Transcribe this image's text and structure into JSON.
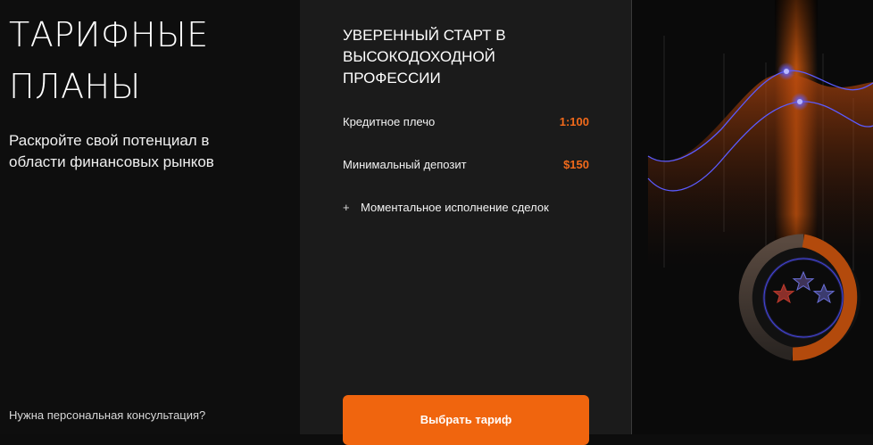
{
  "left": {
    "title_line1": "ТАРИФНЫЕ",
    "title_line2": "ПЛАНЫ",
    "subtitle_line1": "Раскройте свой потенциал в",
    "subtitle_line2": "области финансовых рынков",
    "consultation": "Нужна персональная консультация?"
  },
  "plan": {
    "title_line1": "УВЕРЕННЫЙ СТАРТ В",
    "title_line2": "ВЫСОКОДОХОДНОЙ",
    "title_line3": "ПРОФЕССИИ",
    "rows": [
      {
        "label": "Кредитное плечо",
        "value": "1:100"
      },
      {
        "label": "Минимальный депозит",
        "value": "$150"
      }
    ],
    "feature_icon": "+",
    "feature": "Моментальное исполнение сделок",
    "cta_label": "Выбрать тариф"
  },
  "illustration": {
    "icons": [
      "star-icon",
      "star-icon",
      "star-icon"
    ],
    "rating": {
      "stars_shown": 3
    },
    "colors": {
      "accent": "#f0650e",
      "line": "#5b5bff",
      "star_red": "#c0392b",
      "star_blue": "#6a6fd8"
    }
  },
  "colors": {
    "accent": "#f0650e",
    "value": "#f26a1b",
    "card_bg": "#1b1b1b",
    "page_bg": "#0e0e0e"
  }
}
